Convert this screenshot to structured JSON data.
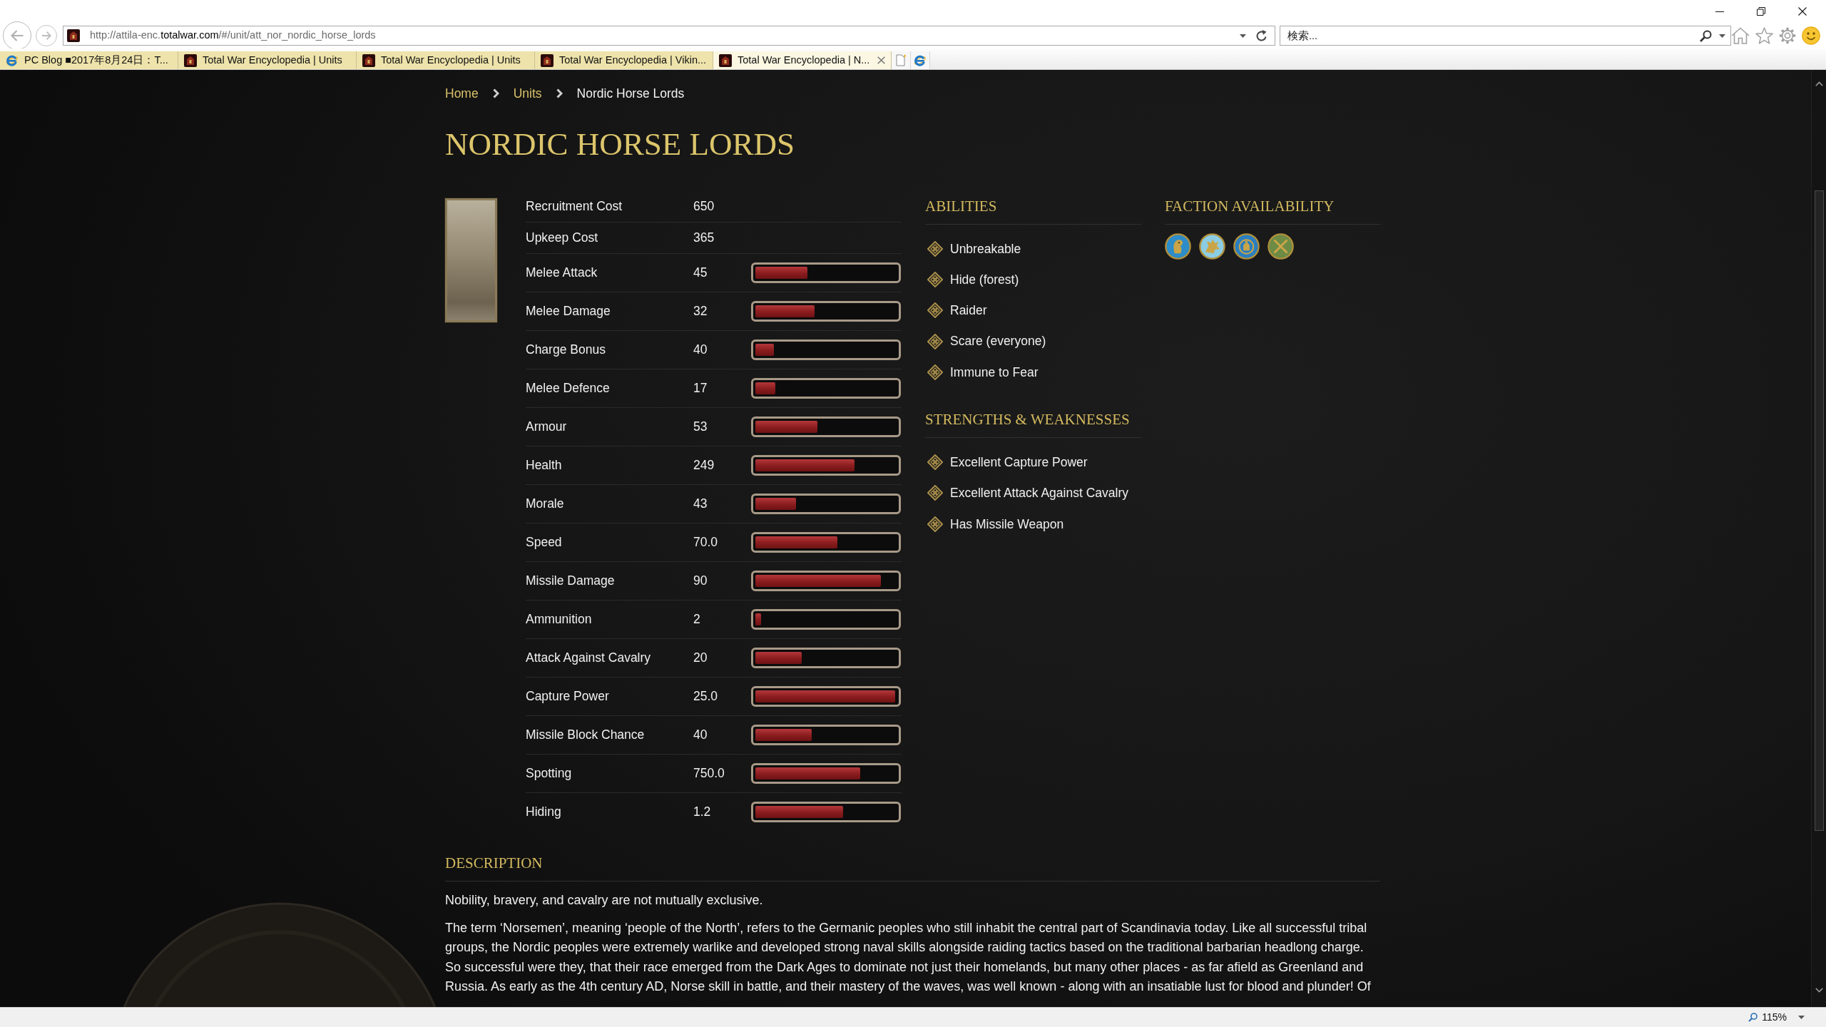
{
  "browser": {
    "address": "http://attila-enc.**totalwar.com**/#/unit/att_nor_nordic_horse_lords",
    "search": {
      "placeholder": "検索..."
    }
  },
  "tabs": [
    {
      "kind": "blog",
      "title": "PC Blog ■2017年8月24日：T...",
      "selected": false
    },
    {
      "kind": "encyclopedia",
      "title": "Total War Encyclopedia | Units",
      "selected": false
    },
    {
      "kind": "encyclopedia",
      "title": "Total War Encyclopedia | Units",
      "selected": false
    },
    {
      "kind": "encyclopedia",
      "title": "Total War Encyclopedia | Vikin...",
      "selected": false
    },
    {
      "kind": "encyclopedia",
      "title": "Total War Encyclopedia | N...",
      "selected": true
    }
  ],
  "breadcrumb": [
    {
      "label": "Home",
      "active": false
    },
    {
      "label": "Units",
      "active": false
    },
    {
      "label": "Nordic Horse Lords",
      "active": true
    }
  ],
  "title": "NORDIC HORSE LORDS",
  "stats": [
    {
      "label": "Recruitment Cost",
      "value": "650"
    },
    {
      "label": "Upkeep Cost",
      "value": "365"
    },
    {
      "label": "Melee Attack",
      "value": "45",
      "level": 0.37
    },
    {
      "label": "Melee Damage",
      "value": "32",
      "level": 0.42
    },
    {
      "label": "Charge Bonus",
      "value": "40",
      "level": 0.13
    },
    {
      "label": "Melee Defence",
      "value": "17",
      "level": 0.14
    },
    {
      "label": "Armour",
      "value": "53",
      "level": 0.44
    },
    {
      "label": "Health",
      "value": "249",
      "level": 0.7
    },
    {
      "label": "Morale",
      "value": "43",
      "level": 0.29
    },
    {
      "label": "Speed",
      "value": "70.0",
      "level": 0.58
    },
    {
      "label": "Missile Damage",
      "value": "90",
      "level": 0.89
    },
    {
      "label": "Ammunition",
      "value": "2",
      "level": 0.04
    },
    {
      "label": "Attack Against Cavalry",
      "value": "20",
      "level": 0.33
    },
    {
      "label": "Capture Power",
      "value": "25.0",
      "level": 0.99
    },
    {
      "label": "Missile Block Chance",
      "value": "40",
      "level": 0.4
    },
    {
      "label": "Spotting",
      "value": "750.0",
      "level": 0.74
    },
    {
      "label": "Hiding",
      "value": "1.2",
      "level": 0.62
    }
  ],
  "abilities": {
    "heading": "ABILITIES",
    "items": [
      "Unbreakable",
      "Hide (forest)",
      "Raider",
      "Scare (everyone)",
      "Immune to Fear"
    ]
  },
  "strengths_weaknesses": {
    "heading": "STRENGTHS & WEAKNESSES",
    "items": [
      "Excellent Capture Power",
      "Excellent Attack Against Cavalry",
      "Has Missile Weapon"
    ]
  },
  "faction_availability": {
    "heading": "FACTION AVAILABILITY",
    "factions": [
      {
        "color": "#2e8dc8"
      },
      {
        "color": "#8ccde3"
      },
      {
        "color": "#2a7fc0"
      },
      {
        "color": "#6d8b45"
      }
    ]
  },
  "description": {
    "heading": "DESCRIPTION",
    "paragraphs": [
      "Nobility, bravery, and cavalry are not mutually exclusive.",
      "The term ‘Norsemen’, meaning ‘people of the North’, refers to the Germanic peoples who still inhabit the central part of Scandinavia today. Like all successful tribal groups, the Nordic peoples were extremely warlike and developed strong naval skills alongside raiding tactics based on the traditional barbarian headlong charge. So successful were they, that their race emerged from the Dark Ages to dominate not just their homelands, but many other places - as far afield as Greenland and Russia. As early as the 4th century AD, Norse skill in battle, and their mastery of the waves, was well known - along with an insatiable lust for blood and plunder! Of"
    ]
  },
  "status_bar": {
    "zoom": "115%"
  }
}
